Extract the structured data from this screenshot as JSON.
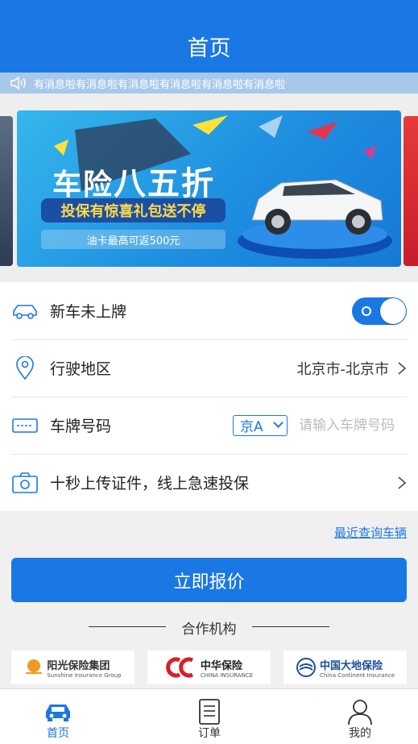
{
  "header": {
    "title": "首页"
  },
  "notice": {
    "text": "有消息啦有消息啦有消息啦有消息啦有消息啦有消息啦"
  },
  "banner": {
    "headline_a": "车险",
    "headline_b": "八五折",
    "subline": "投保有惊喜礼包送不停",
    "promo": "油卡最高可返500元"
  },
  "form": {
    "new_car": {
      "label": "新车未上牌",
      "toggle_on": true
    },
    "region": {
      "label": "行驶地区",
      "value": "北京市-北京市"
    },
    "plate": {
      "label": "车牌号码",
      "prefix": "京A",
      "placeholder": "请输入车牌号码"
    },
    "upload": {
      "label": "十秒上传证件，线上急速投保"
    }
  },
  "recent_link": "最近查询车辆",
  "quote_button": "立即报价",
  "partners": {
    "title": "合作机构",
    "items": [
      {
        "name": "阳光保险集团",
        "en": "Sunshine Insurance Group",
        "color": "#f39a1e"
      },
      {
        "name": "中华保险",
        "en": "CHINA INSURANCE",
        "color": "#d81e28"
      },
      {
        "name": "中国大地保险",
        "en": "China Continent Insurance",
        "color": "#1c4e9a"
      }
    ]
  },
  "tabbar": {
    "items": [
      {
        "label": "首页",
        "icon": "car-icon",
        "active": true
      },
      {
        "label": "订单",
        "icon": "order-list-icon",
        "active": false
      },
      {
        "label": "我的",
        "icon": "user-icon",
        "active": false
      }
    ]
  },
  "colors": {
    "primary": "#1a78e4",
    "notice_bg": "#a8c8ea",
    "page_bg": "#f0f0f0"
  }
}
